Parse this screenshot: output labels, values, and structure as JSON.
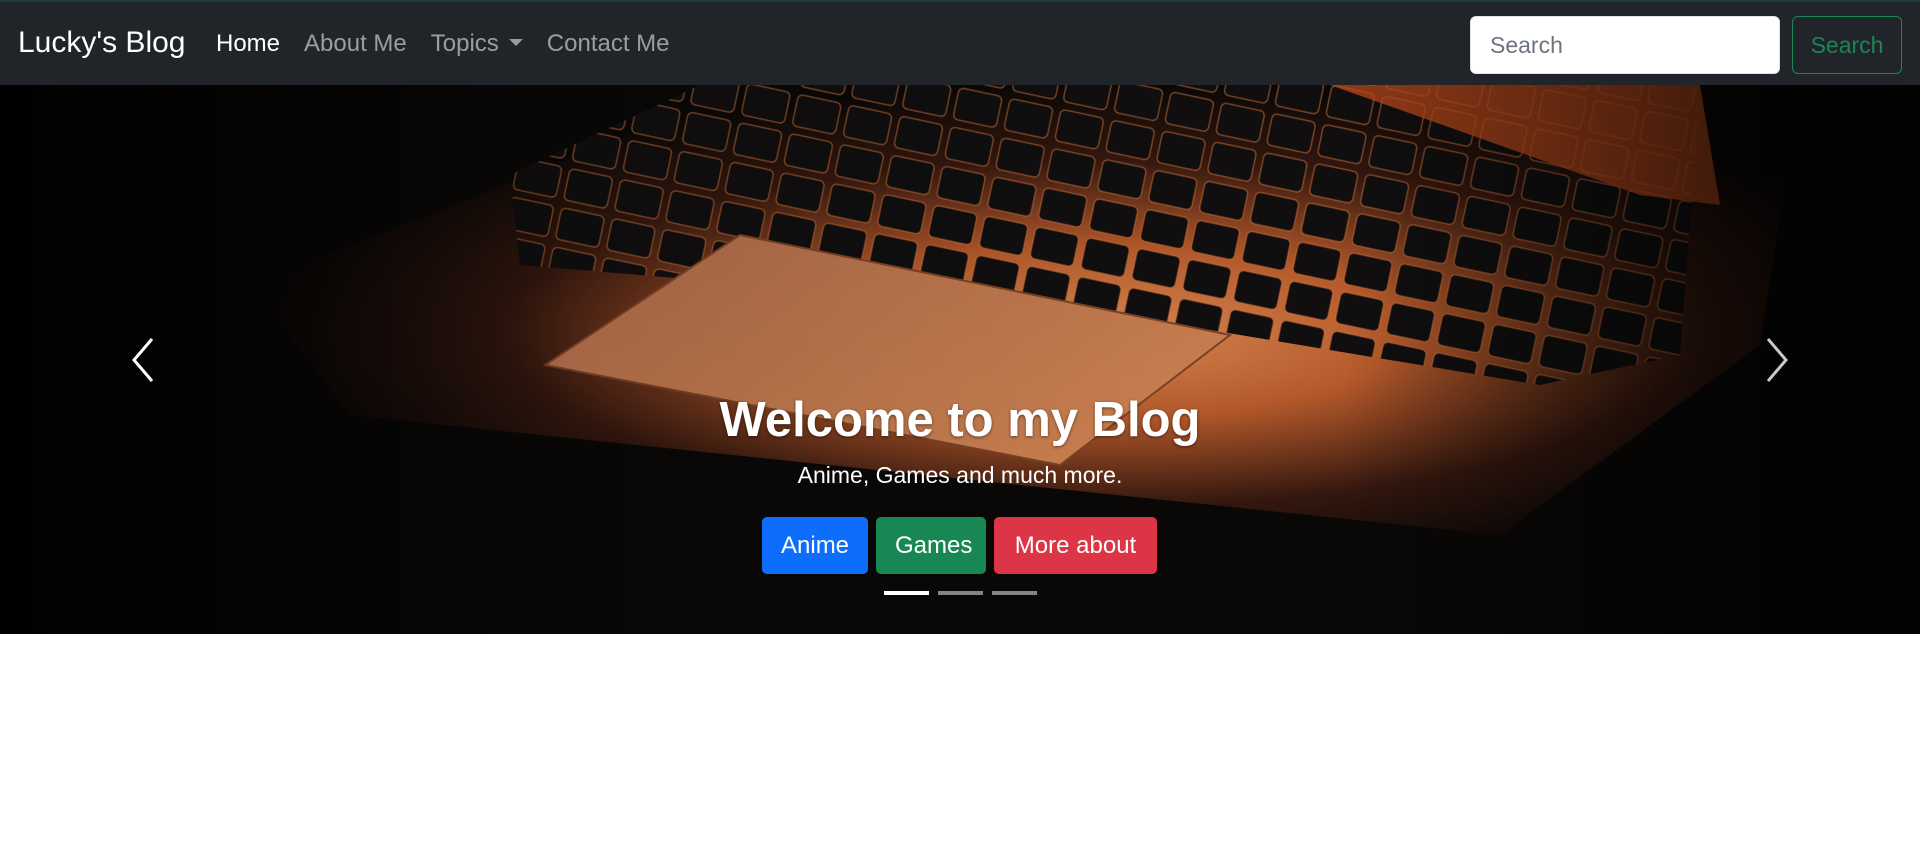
{
  "navbar": {
    "brand": "Lucky's Blog",
    "links": [
      {
        "label": "Home",
        "active": true
      },
      {
        "label": "About Me"
      },
      {
        "label": "Topics",
        "dropdown": true
      },
      {
        "label": "Contact Me"
      }
    ],
    "search_placeholder": "Search",
    "search_button": "Search"
  },
  "carousel": {
    "title": "Welcome to my Blog",
    "subtitle": "Anime, Games and much more.",
    "buttons": [
      {
        "label": "Anime",
        "color": "#0d6efd"
      },
      {
        "label": "Games",
        "color": "#198754"
      },
      {
        "label": "More about",
        "color": "#dc3545"
      }
    ],
    "indicators_count": 3,
    "active_indicator": 1,
    "prev_icon": "chevron-left-icon",
    "next_icon": "chevron-right-icon"
  },
  "colors": {
    "navbar_bg": "#212529",
    "search_accent": "#198754"
  }
}
